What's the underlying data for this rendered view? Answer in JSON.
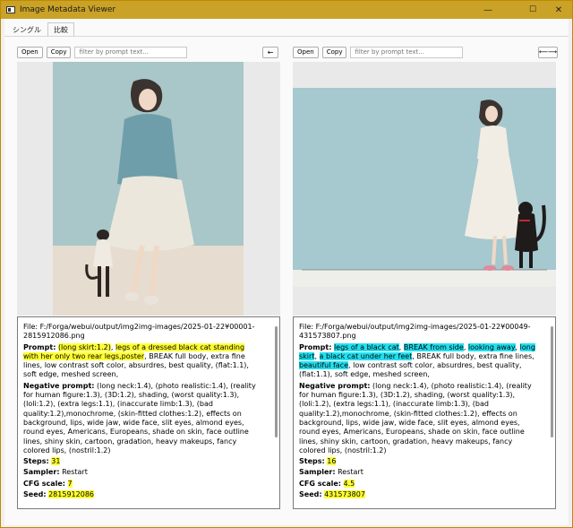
{
  "window": {
    "title": "Image Metadata Viewer",
    "controls": [
      "—",
      "☐",
      "✕"
    ]
  },
  "tabs": [
    {
      "label": "シングル",
      "active": false
    },
    {
      "label": "比較",
      "active": true
    }
  ],
  "left": {
    "toolbar": {
      "open": "Open",
      "copy": "Copy",
      "filter_placeholder": "filter by prompt text...",
      "arrow": "←"
    },
    "file_label": "File:",
    "file_path": "F:/Forga/webui/output/img2img-images/2025-01-22¥00001-2815912086.png",
    "prompt_label": "Prompt:",
    "prompt_segments": [
      {
        "t": "(long skirt:1.2)",
        "hl": "y"
      },
      {
        "t": ", ",
        "hl": ""
      },
      {
        "t": "legs of a dressed black cat standing with her only two rear legs,poster",
        "hl": "y"
      },
      {
        "t": ", BREAK full body, extra fine lines, low contrast soft color, absurdres, best quality, (flat:1.1), soft edge, meshed screen,",
        "hl": ""
      }
    ],
    "neg_label": "Negative prompt:",
    "neg_text": "(long neck:1.4), (photo realistic:1.4), (reality for human figure:1.3), (3D:1.2), shading, (worst quality:1.3), (loli:1.2), (extra legs:1.1), (inaccurate limb:1.3), (bad quality:1.2),monochrome, (skin-fitted clothes:1.2), effects on background, lips, wide jaw, wide face, slit eyes, almond eyes, round eyes, Americans, Europeans, shade on skin, face outline lines, shiny skin, cartoon, gradation, heavy makeups, fancy colored lips, (nostril:1.2)",
    "steps_label": "Steps:",
    "steps": "31",
    "sampler_label": "Sampler:",
    "sampler": "Restart",
    "cfg_label": "CFG scale:",
    "cfg": "7",
    "seed_label": "Seed:",
    "seed": "2815912086"
  },
  "right": {
    "toolbar": {
      "open": "Open",
      "copy": "Copy",
      "filter_placeholder": "filter by prompt text...",
      "arrow": "⟵⟶"
    },
    "file_label": "File:",
    "file_path": "F:/Forga/webui/output/img2img-images/2025-01-22¥00049-431573807.png",
    "prompt_label": "Prompt:",
    "prompt_segments": [
      {
        "t": "legs of a black cat",
        "hl": "c"
      },
      {
        "t": ", ",
        "hl": ""
      },
      {
        "t": "BREAK from side",
        "hl": "c"
      },
      {
        "t": ", ",
        "hl": ""
      },
      {
        "t": "looking away",
        "hl": "c"
      },
      {
        "t": ", ",
        "hl": ""
      },
      {
        "t": "long skirt",
        "hl": "c"
      },
      {
        "t": ", ",
        "hl": ""
      },
      {
        "t": "a black cat under her feet",
        "hl": "c"
      },
      {
        "t": ", BREAK full body, extra fine lines, ",
        "hl": ""
      },
      {
        "t": "beautiful face",
        "hl": "c"
      },
      {
        "t": ", low contrast soft color, absurdres, best quality, (flat:1.1), soft edge, meshed screen,",
        "hl": ""
      }
    ],
    "neg_label": "Negative prompt:",
    "neg_text": "(long neck:1.4), (photo realistic:1.4), (reality for human figure:1.3), (3D:1.2), shading, (worst quality:1.3), (loli:1.2), (extra legs:1.1), (inaccurate limb:1.3), (bad quality:1.2),monochrome, (skin-fitted clothes:1.2), effects on background, lips, wide jaw, wide face, slit eyes, almond eyes, round eyes, Americans, Europeans, shade on skin, face outline lines, shiny skin, cartoon, gradation, heavy makeups, fancy colored lips, (nostril:1.2)",
    "steps_label": "Steps:",
    "steps": "16",
    "sampler_label": "Sampler:",
    "sampler": "Restart",
    "cfg_label": "CFG scale:",
    "cfg": "4.5",
    "seed_label": "Seed:",
    "seed": "431573807"
  },
  "colors": {
    "title_bar": "#c9a227",
    "highlight_yellow": "#ffff33",
    "highlight_cyan": "#22e0f0"
  }
}
